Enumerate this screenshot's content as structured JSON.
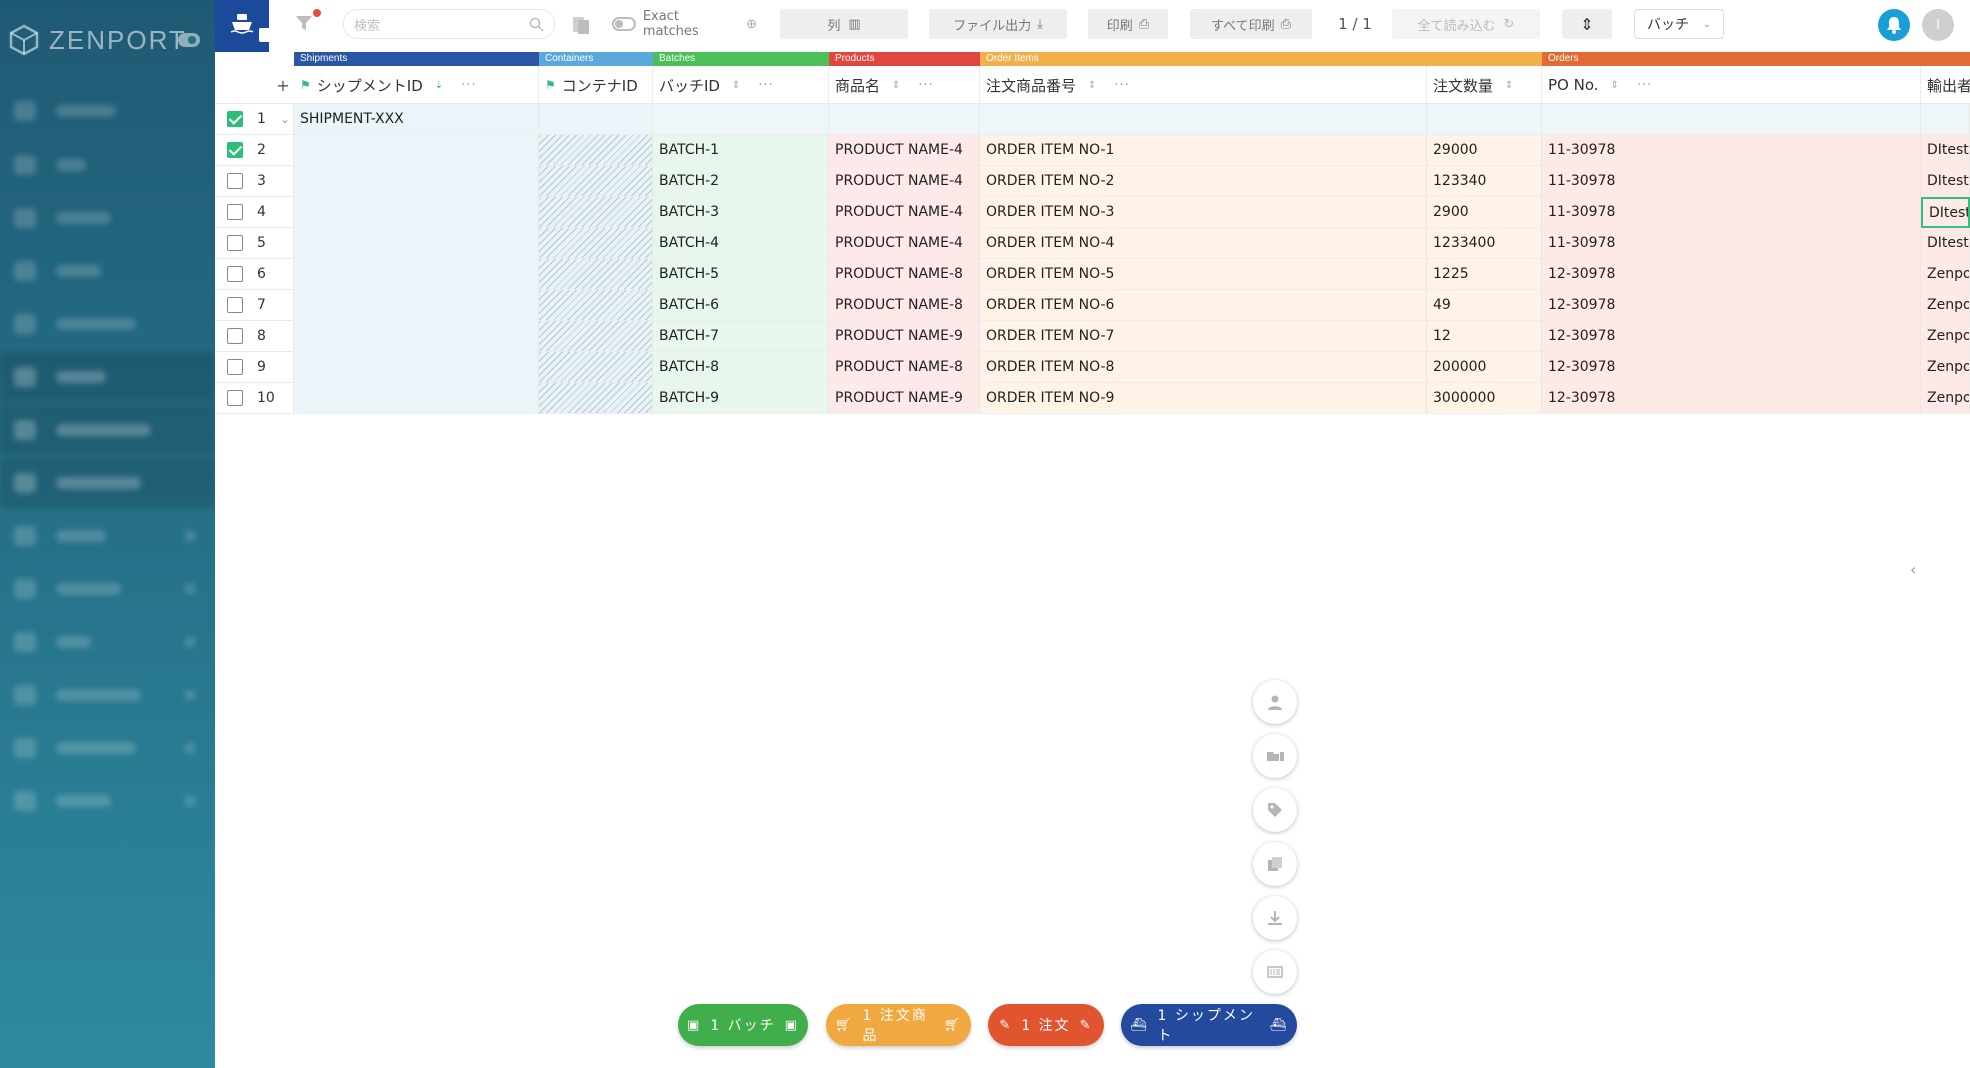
{
  "sidebar": {
    "logo_text": "ZENPORT"
  },
  "toolbar": {
    "search_placeholder": "検索",
    "exact_matches_label": "Exact matches",
    "columns_label": "列",
    "export_label": "ファイル出力",
    "print_label": "印刷",
    "print_all_label": "すべて印刷",
    "page_indicator": "1 / 1",
    "load_all_label": "全て読み込む",
    "view_select_value": "バッチ",
    "avatar_initial": "I"
  },
  "groups": [
    {
      "label": "Shipments",
      "color": "#2b56a6"
    },
    {
      "label": "Containers",
      "color": "#5aa8dc"
    },
    {
      "label": "Batches",
      "color": "#4bbf5a"
    },
    {
      "label": "Products",
      "color": "#e2473f"
    },
    {
      "label": "Order Items",
      "color": "#f2b04a"
    },
    {
      "label": "Orders",
      "color": "#e46a33"
    }
  ],
  "columns": {
    "shipment_id": "シップメントID",
    "container_id": "コンテナID",
    "batch_id": "バッチID",
    "product_name": "商品名",
    "order_item_no": "注文商品番号",
    "order_qty": "注文数量",
    "po_no": "PO No.",
    "exporter": "輸出者"
  },
  "rows": [
    {
      "num": "1",
      "checked": true,
      "shipment": "SHIPMENT-XXX",
      "batch": "",
      "product": "",
      "item": "",
      "qty": "",
      "po": "",
      "exporter": ""
    },
    {
      "num": "2",
      "checked": true,
      "shipment": "",
      "batch": "BATCH-1",
      "product": "PRODUCT NAME-4",
      "item": "ORDER ITEM NO-1",
      "qty": "29000",
      "po": "11-30978",
      "exporter": "DItest"
    },
    {
      "num": "3",
      "checked": false,
      "shipment": "",
      "batch": "BATCH-2",
      "product": "PRODUCT NAME-4",
      "item": "ORDER ITEM NO-2",
      "qty": "123340",
      "po": "11-30978",
      "exporter": "DItest"
    },
    {
      "num": "4",
      "checked": false,
      "shipment": "",
      "batch": "BATCH-3",
      "product": "PRODUCT NAME-4",
      "item": "ORDER ITEM NO-3",
      "qty": "2900",
      "po": "11-30978",
      "exporter": "DItest"
    },
    {
      "num": "5",
      "checked": false,
      "shipment": "",
      "batch": "BATCH-4",
      "product": "PRODUCT NAME-4",
      "item": "ORDER ITEM NO-4",
      "qty": "1233400",
      "po": "11-30978",
      "exporter": "DItest"
    },
    {
      "num": "6",
      "checked": false,
      "shipment": "",
      "batch": "BATCH-5",
      "product": "PRODUCT NAME-8",
      "item": "ORDER ITEM NO-5",
      "qty": "1225",
      "po": "12-30978",
      "exporter": "Zenpo"
    },
    {
      "num": "7",
      "checked": false,
      "shipment": "",
      "batch": "BATCH-6",
      "product": "PRODUCT NAME-8",
      "item": "ORDER ITEM NO-6",
      "qty": "49",
      "po": "12-30978",
      "exporter": "Zenpo"
    },
    {
      "num": "8",
      "checked": false,
      "shipment": "",
      "batch": "BATCH-7",
      "product": "PRODUCT NAME-9",
      "item": "ORDER ITEM NO-7",
      "qty": "12",
      "po": "12-30978",
      "exporter": "Zenpo"
    },
    {
      "num": "9",
      "checked": false,
      "shipment": "",
      "batch": "BATCH-8",
      "product": "PRODUCT NAME-8",
      "item": "ORDER ITEM NO-8",
      "qty": "200000",
      "po": "12-30978",
      "exporter": "Zenpo"
    },
    {
      "num": "10",
      "checked": false,
      "shipment": "",
      "batch": "BATCH-9",
      "product": "PRODUCT NAME-9",
      "item": "ORDER ITEM NO-9",
      "qty": "3000000",
      "po": "12-30978",
      "exporter": "Zenpo"
    }
  ],
  "bottom_pills": [
    {
      "label": "1 バッチ",
      "color": "#3fae4b"
    },
    {
      "label": "1 注文商品",
      "color": "#f0a940"
    },
    {
      "label": "1 注文",
      "color": "#e0552f"
    },
    {
      "label": "1 シップメント",
      "color": "#234a9c"
    }
  ],
  "colors": {
    "shipment_bg": "#eaf4f9",
    "batch_bg": "#e8f7eb",
    "product_bg": "#fde9e8",
    "order_item_bg": "#fef3e6",
    "order_bg": "#fde9e6"
  }
}
